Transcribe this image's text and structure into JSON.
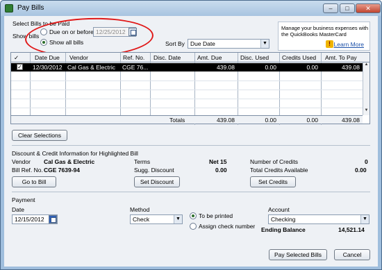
{
  "window": {
    "title": "Pay Bills",
    "controls": {
      "minimize": "–",
      "maximize": "□",
      "close": "✕"
    }
  },
  "select": {
    "section_title": "Select Bills to be Paid",
    "show_bills_label": "Show bills",
    "due_on_or_before_label": "Due on or before",
    "due_date_value": "12/25/2012",
    "show_all_label": "Show all bills",
    "selected_filter": "show_all",
    "sort_by_label": "Sort By",
    "sort_by_value": "Due Date"
  },
  "ad": {
    "line1": "Manage your business expenses with",
    "line2": "the QuickBooks MasterCard",
    "link": "Learn More",
    "icon": "!"
  },
  "grid": {
    "headers": [
      "✓",
      "Date Due",
      "Vendor",
      "Ref. No.",
      "Disc. Date",
      "Amt. Due",
      "Disc. Used",
      "Credits Used",
      "Amt. To Pay"
    ],
    "rows": [
      {
        "checked": "✓",
        "date_due": "12/30/2012",
        "vendor": "Cal Gas & Electric",
        "ref": "CGE 76...",
        "disc_date": "",
        "amt_due": "439.08",
        "disc_used": "0.00",
        "credits_used": "0.00",
        "amt_to_pay": "439.08"
      }
    ],
    "totals": {
      "label": "Totals",
      "amt_due": "439.08",
      "disc_used": "0.00",
      "credits_used": "0.00",
      "amt_to_pay": "439.08"
    }
  },
  "buttons": {
    "clear_selections": "Clear Selections",
    "go_to_bill": "Go to Bill",
    "set_discount": "Set Discount",
    "set_credits": "Set Credits",
    "pay_selected": "Pay Selected Bills",
    "cancel": "Cancel"
  },
  "discount": {
    "section_title": "Discount & Credit Information for Highlighted Bill",
    "vendor_label": "Vendor",
    "vendor_value": "Cal Gas & Electric",
    "bill_ref_label": "Bill Ref. No.",
    "bill_ref_value": "CGE 7639-94",
    "terms_label": "Terms",
    "terms_value": "Net 15",
    "sugg_discount_label": "Sugg. Discount",
    "sugg_discount_value": "0.00",
    "num_credits_label": "Number of Credits",
    "num_credits_value": "0",
    "total_credits_label": "Total Credits Available",
    "total_credits_value": "0.00"
  },
  "payment": {
    "section_title": "Payment",
    "date_label": "Date",
    "date_value": "12/15/2012",
    "method_label": "Method",
    "method_value": "Check",
    "to_be_printed_label": "To be printed",
    "assign_check_label": "Assign check number",
    "selected_option": "to_be_printed",
    "account_label": "Account",
    "account_value": "Checking",
    "ending_balance_label": "Ending Balance",
    "ending_balance_value": "14,521.14"
  },
  "colors": {
    "selected_row_bg": "#000000",
    "link": "#1a4fa8",
    "annotation_circle": "#e01818"
  }
}
